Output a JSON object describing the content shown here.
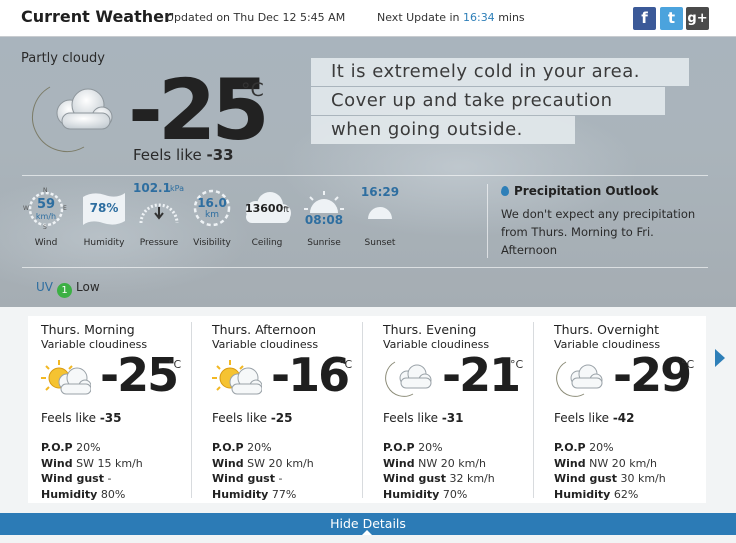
{
  "header": {
    "title": "Current Weather",
    "updated_prefix": "Updated on",
    "updated_value": "Thu Dec 12 5:45 AM",
    "next_update_prefix": "Next Update in",
    "next_update_time": "16:34",
    "next_update_suffix": "mins",
    "social": {
      "facebook": "f",
      "twitter": "t",
      "googleplus": "g+"
    }
  },
  "current": {
    "condition": "Partly cloudy",
    "icon": "partly-cloudy-night-icon",
    "temperature": "-25",
    "unit": "°C",
    "feels_like_label": "Feels like",
    "feels_like_value": "-33",
    "alert_lines": [
      "It is extremely cold in your area.",
      "Cover up and take precaution",
      "when going outside."
    ]
  },
  "stats": {
    "wind": {
      "label": "Wind",
      "value": "59",
      "unit": "km/h",
      "directions": [
        "N",
        "E",
        "S",
        "W"
      ]
    },
    "humidity": {
      "label": "Humidity",
      "value": "78%"
    },
    "pressure": {
      "label": "Pressure",
      "value": "102.1",
      "unit": "kPa"
    },
    "visibility": {
      "label": "Visibility",
      "value": "16.0",
      "unit": "km"
    },
    "ceiling": {
      "label": "Ceiling",
      "value": "13600",
      "unit": "ft"
    },
    "sunrise": {
      "label": "Sunrise",
      "value": "08:08"
    },
    "sunset": {
      "label": "Sunset",
      "value": "16:29"
    }
  },
  "precipitation": {
    "title": "Precipitation Outlook",
    "text": "We don't expect any precipitation from Thurs. Morning to Fri. Afternoon"
  },
  "uv": {
    "label": "UV",
    "index": "1",
    "level": "Low"
  },
  "forecast": [
    {
      "period": "Thurs. Morning",
      "condition": "Variable cloudiness",
      "icon": "partly-cloudy-day-icon",
      "temp": "-25",
      "unit": "°C",
      "feels_label": "Feels like",
      "feels": "-35",
      "pop_label": "P.O.P",
      "pop": "20%",
      "wind_label": "Wind",
      "wind": "SW 15 km/h",
      "gust_label": "Wind gust",
      "gust": "-",
      "humidity_label": "Humidity",
      "humidity": "80%"
    },
    {
      "period": "Thurs. Afternoon",
      "condition": "Variable cloudiness",
      "icon": "partly-cloudy-day-icon",
      "temp": "-16",
      "unit": "°C",
      "feels_label": "Feels like",
      "feels": "-25",
      "pop_label": "P.O.P",
      "pop": "20%",
      "wind_label": "Wind",
      "wind": "SW 20 km/h",
      "gust_label": "Wind gust",
      "gust": "-",
      "humidity_label": "Humidity",
      "humidity": "77%"
    },
    {
      "period": "Thurs. Evening",
      "condition": "Variable cloudiness",
      "icon": "partly-cloudy-night-icon",
      "temp": "-21",
      "unit": "°C",
      "feels_label": "Feels like",
      "feels": "-31",
      "pop_label": "P.O.P",
      "pop": "20%",
      "wind_label": "Wind",
      "wind": "NW 20 km/h",
      "gust_label": "Wind gust",
      "gust": "32 km/h",
      "humidity_label": "Humidity",
      "humidity": "70%"
    },
    {
      "period": "Thurs. Overnight",
      "condition": "Variable cloudiness",
      "icon": "partly-cloudy-night-icon",
      "temp": "-29",
      "unit": "°C",
      "feels_label": "Feels like",
      "feels": "-42",
      "pop_label": "P.O.P",
      "pop": "20%",
      "wind_label": "Wind",
      "wind": "NW 20 km/h",
      "gust_label": "Wind gust",
      "gust": "30 km/h",
      "humidity_label": "Humidity",
      "humidity": "62%"
    }
  ],
  "footer": {
    "hide_details": "Hide Details"
  },
  "colors": {
    "accent": "#2e7fb8",
    "bar": "#2c7bb6",
    "uv_low": "#3cb044"
  }
}
